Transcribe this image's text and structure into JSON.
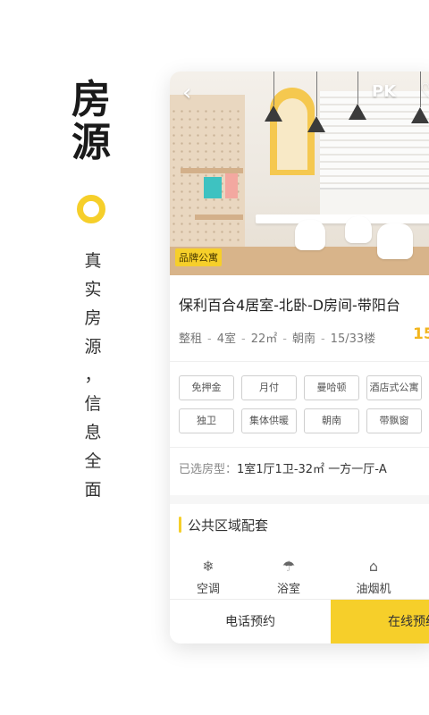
{
  "promo": {
    "title_chars": [
      "房",
      "源"
    ],
    "subtitle_chars": [
      "真",
      "实",
      "房",
      "源",
      "，",
      "信",
      "息",
      "全",
      "面"
    ]
  },
  "card": {
    "header": {
      "back_icon": "chevron-left-icon",
      "pk_label": "PK",
      "fav_icon": "heart-icon"
    },
    "badge": "品牌公寓",
    "title": "保利百合4居室-北卧-D房间-带阳台",
    "meta": [
      "整租",
      "4室",
      "22㎡",
      "朝南",
      "15/33楼"
    ],
    "price_partial": "15",
    "tags": [
      "免押金",
      "月付",
      "曼哈顿",
      "酒店式公寓",
      "独卫",
      "集体供暖",
      "朝南",
      "带飘窗"
    ],
    "selected_type": {
      "label": "已选房型：",
      "value": "1室1厅1卫-32㎡ 一方一厅-A"
    },
    "section": {
      "title": "公共区域配套"
    },
    "amenities": [
      {
        "icon": "snowflake-icon",
        "label": "空调"
      },
      {
        "icon": "shower-icon",
        "label": "浴室"
      },
      {
        "icon": "range-hood-icon",
        "label": "油烟机"
      }
    ],
    "actions": {
      "call": "电话预约",
      "book": "在线预约"
    }
  },
  "colors": {
    "accent": "#f6cf2a",
    "price": "#f2b51d"
  }
}
